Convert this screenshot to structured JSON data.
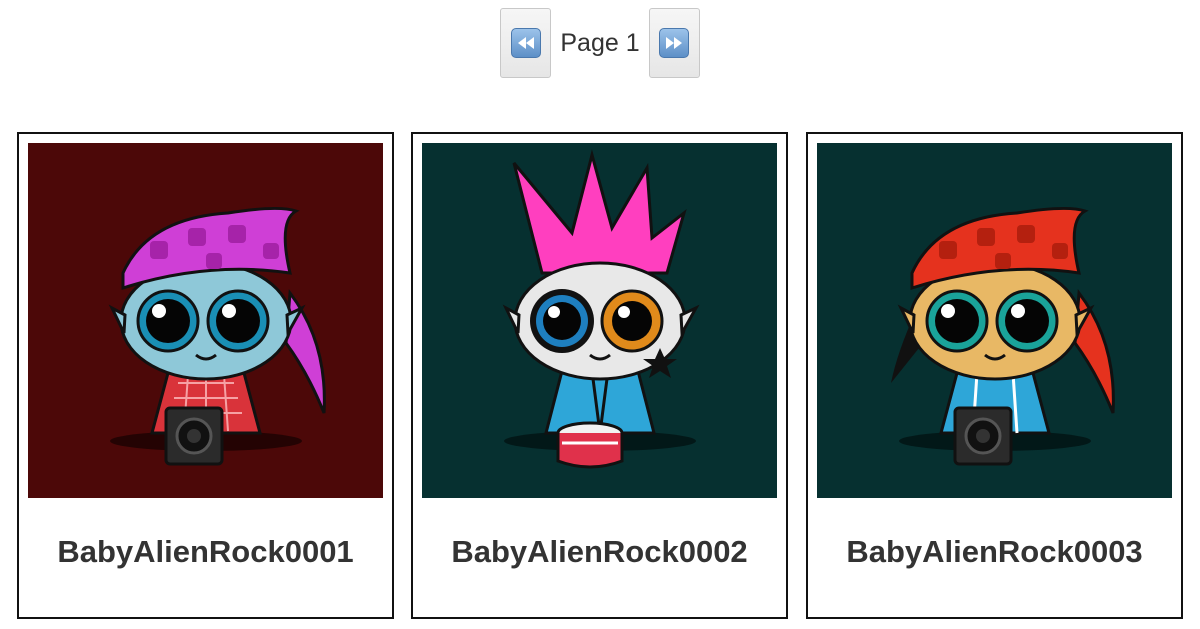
{
  "pagination": {
    "page_label": "Page 1",
    "prev_icon": "rewind-icon",
    "next_icon": "fast-forward-icon"
  },
  "cards": [
    {
      "title": "BabyAlienRock0001",
      "background": "#4c0808",
      "skin": "#8ec8d8",
      "hat": "#cf3fd6",
      "hat_dark": "#a623a9",
      "accessory": "speaker",
      "shirt": "red-plaid"
    },
    {
      "title": "BabyAlienRock0002",
      "background": "#063030",
      "skin": "#e8e8e8",
      "hair": "#ff3fbf",
      "accessory": "drum",
      "shirt": "blue-jacket"
    },
    {
      "title": "BabyAlienRock0003",
      "background": "#063030",
      "skin": "#e8b865",
      "hat": "#e5321e",
      "hat_dark": "#b4200f",
      "accessory": "speaker",
      "shirt": "blue-tracksuit"
    }
  ]
}
